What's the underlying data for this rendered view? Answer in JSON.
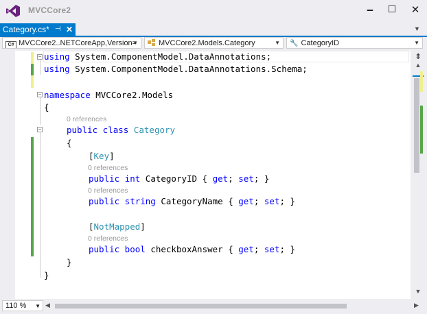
{
  "window": {
    "title": "MVCCore2",
    "minimize_glyph": "🗕",
    "maximize_glyph": "☐",
    "close_glyph": "✕"
  },
  "tab": {
    "label": "Category.cs*",
    "pin_glyph": "⊣",
    "close_glyph": "✕"
  },
  "navbar": {
    "project": "MVCCore2..NETCoreApp,Version=",
    "class": "MVCCore2.Models.Category",
    "member": "CategoryID"
  },
  "editor": {
    "lines": {
      "l1_kw": "using",
      "l1_rest": " System.ComponentModel.DataAnnotations;",
      "l2_kw": "using",
      "l2_rest": " System.ComponentModel.DataAnnotations.Schema;",
      "l4_kw": "namespace",
      "l4_rest": " MVCCore2.Models",
      "l5": "{",
      "lens_class": "0 references",
      "l6_kw": "public class",
      "l6_type": "Category",
      "l7": "{",
      "l8_open": "[",
      "l8_attr": "Key",
      "l8_close": "]",
      "lens_id": "0 references",
      "l9_kw": "public int",
      "l9_rest": " CategoryID { ",
      "l9_get": "get",
      "l9_mid": "; ",
      "l9_set": "set",
      "l9_end": "; }",
      "lens_name": "0 references",
      "l10_kw": "public string",
      "l10_rest": " CategoryName { ",
      "l10_get": "get",
      "l10_mid": "; ",
      "l10_set": "set",
      "l10_end": "; }",
      "l12_open": "[",
      "l12_attr": "NotMapped",
      "l12_close": "]",
      "lens_cb": "0 references",
      "l13_kw": "public bool",
      "l13_rest": " checkboxAnswer { ",
      "l13_get": "get",
      "l13_mid": "; ",
      "l13_set": "set",
      "l13_end": "; }",
      "l14": "}",
      "l15": "}"
    }
  },
  "zoom": {
    "value": "110 %"
  },
  "colors": {
    "accent": "#007acc",
    "keyword": "#0000ff",
    "type": "#2b91af",
    "saved_change": "#57a64a",
    "unsaved_change": "#efef8f"
  },
  "icons": [
    "vs-logo-icon",
    "pin-icon",
    "close-icon",
    "csharp-project-icon",
    "class-icon",
    "member-icon",
    "dropdown-arrow-icon",
    "split-icon",
    "scroll-up-icon",
    "scroll-down-icon",
    "scroll-left-icon",
    "scroll-right-icon",
    "collapse-icon"
  ]
}
